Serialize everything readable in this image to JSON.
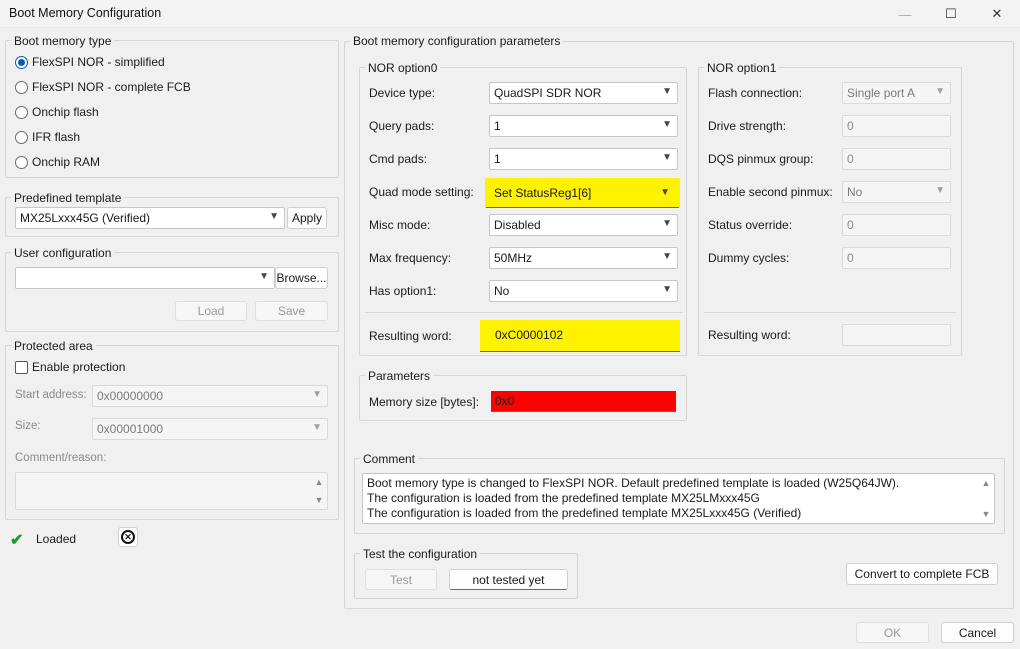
{
  "window": {
    "title": "Boot Memory Configuration",
    "minimize": "—",
    "maximize": "☐",
    "close": "✕"
  },
  "boot_memory_type": {
    "legend": "Boot memory type",
    "options": [
      {
        "label": "FlexSPI NOR - simplified",
        "checked": true
      },
      {
        "label": "FlexSPI NOR - complete FCB",
        "checked": false
      },
      {
        "label": "Onchip flash",
        "checked": false
      },
      {
        "label": "IFR flash",
        "checked": false
      },
      {
        "label": "Onchip RAM",
        "checked": false
      }
    ]
  },
  "predefined_template": {
    "legend": "Predefined template",
    "value": "MX25Lxxx45G (Verified)",
    "apply": "Apply"
  },
  "user_configuration": {
    "legend": "User configuration",
    "value": "",
    "browse": "Browse...",
    "load": "Load",
    "save": "Save"
  },
  "protected_area": {
    "legend": "Protected area",
    "enable": "Enable protection",
    "start_label": "Start address:",
    "start_value": "0x00000000",
    "size_label": "Size:",
    "size_value": "0x00001000",
    "comment_label": "Comment/reason:"
  },
  "status": {
    "text": "Loaded"
  },
  "params": {
    "legend": "Boot memory configuration parameters",
    "nor0": {
      "legend": "NOR option0",
      "rows": [
        {
          "label": "Device type:",
          "value": "QuadSPI SDR NOR"
        },
        {
          "label": "Query pads:",
          "value": "1"
        },
        {
          "label": "Cmd pads:",
          "value": "1"
        },
        {
          "label": "Quad mode setting:",
          "value": "Set StatusReg1[6]"
        },
        {
          "label": "Misc mode:",
          "value": "Disabled"
        },
        {
          "label": "Max frequency:",
          "value": "50MHz"
        },
        {
          "label": "Has option1:",
          "value": "No"
        }
      ],
      "result_label": "Resulting word:",
      "result_value": "0xC0000102"
    },
    "nor1": {
      "legend": "NOR option1",
      "rows": [
        {
          "label": "Flash connection:",
          "value": "Single port A"
        },
        {
          "label": "Drive strength:",
          "value": "0"
        },
        {
          "label": "DQS pinmux group:",
          "value": "0"
        },
        {
          "label": "Enable second pinmux:",
          "value": "No"
        },
        {
          "label": "Status override:",
          "value": "0"
        },
        {
          "label": "Dummy cycles:",
          "value": "0"
        }
      ],
      "result_label": "Resulting word:",
      "result_value": ""
    },
    "parameters": {
      "legend": "Parameters",
      "memsize_label": "Memory size [bytes]:",
      "memsize_value": "0x0"
    }
  },
  "comment": {
    "legend": "Comment",
    "lines": [
      "Boot memory type is changed to FlexSPI NOR. Default predefined template is loaded (W25Q64JW).",
      "The configuration is loaded from the predefined template MX25LMxxx45G",
      "The configuration is loaded from the predefined template MX25Lxxx45G (Verified)"
    ]
  },
  "test": {
    "legend": "Test the configuration",
    "test_button": "Test",
    "status": "not tested yet"
  },
  "convert_button": "Convert to complete FCB",
  "ok_button": "OK",
  "cancel_button": "Cancel",
  "colors": {
    "highlight_yellow": "#fff200",
    "error_red": "#ff0000",
    "accent": "#005fb8",
    "check_green": "#1a9c2a"
  }
}
